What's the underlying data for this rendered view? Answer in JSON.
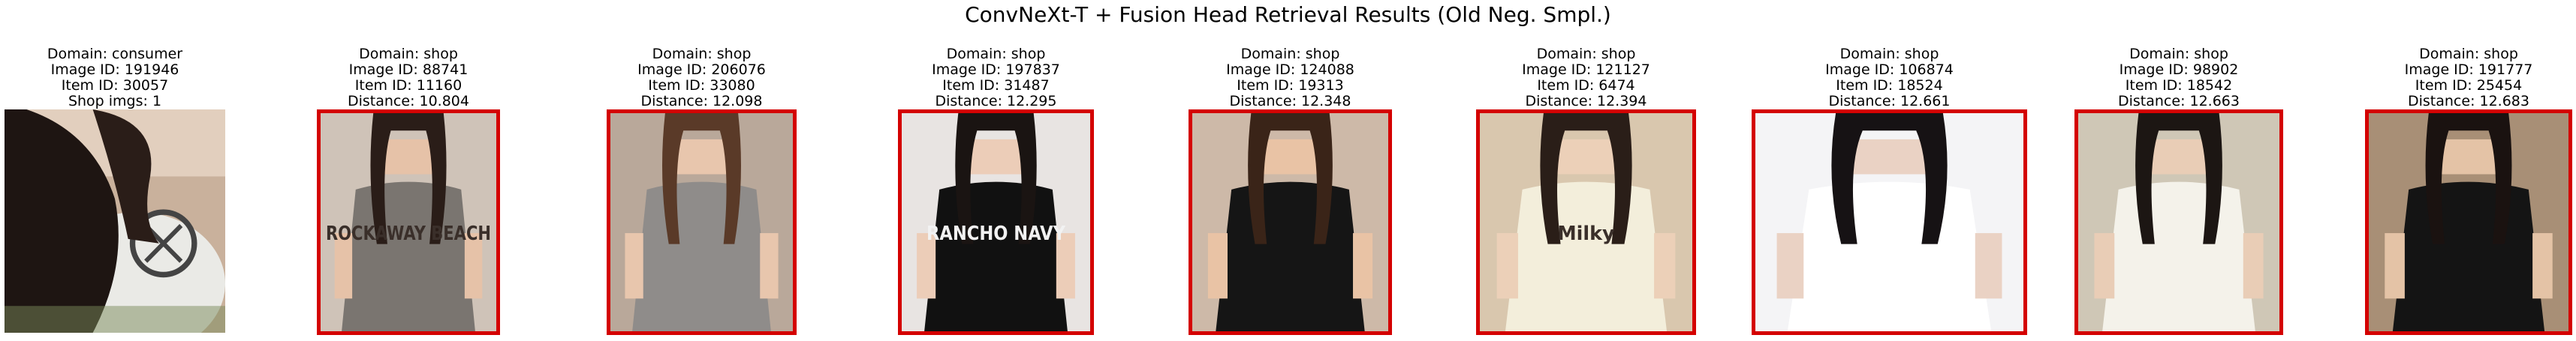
{
  "title": "ConvNeXt-T + Fusion Head Retrieval Results (Old Neg. Smpl.)",
  "query": {
    "domain": "Domain: consumer",
    "image_id": "Image ID: 191946",
    "item_id": "Item ID: 30057",
    "extra": "Shop imgs: 1"
  },
  "results": [
    {
      "domain": "Domain: shop",
      "image_id": "Image ID: 88741",
      "item_id": "Item ID: 11160",
      "distance": "Distance: 10.804",
      "palette": {
        "bg": "#cfc3b8",
        "shirt": "#7a7570",
        "hair": "#2a1d18",
        "skin": "#e6c2a8"
      },
      "print": "ROCKAWAY BEACH"
    },
    {
      "domain": "Domain: shop",
      "image_id": "Image ID: 206076",
      "item_id": "Item ID: 33080",
      "distance": "Distance: 12.098",
      "palette": {
        "bg": "#b9a89a",
        "shirt": "#8f8c8a",
        "hair": "#5a3a28",
        "skin": "#e8c6ad"
      },
      "print": ""
    },
    {
      "domain": "Domain: shop",
      "image_id": "Image ID: 197837",
      "item_id": "Item ID: 31487",
      "distance": "Distance: 12.295",
      "palette": {
        "bg": "#e8e4e2",
        "shirt": "#111111",
        "hair": "#1a1412",
        "skin": "#eccdb8"
      },
      "print": "RANCHO NAVY"
    },
    {
      "domain": "Domain: shop",
      "image_id": "Image ID: 124088",
      "item_id": "Item ID: 19313",
      "distance": "Distance: 12.348",
      "palette": {
        "bg": "#cdb9a8",
        "shirt": "#151515",
        "hair": "#3a2418",
        "skin": "#e9c3a5"
      },
      "print": ""
    },
    {
      "domain": "Domain: shop",
      "image_id": "Image ID: 121127",
      "item_id": "Item ID: 6474",
      "distance": "Distance: 12.394",
      "palette": {
        "bg": "#d9c7ae",
        "shirt": "#f3eedb",
        "hair": "#2a1e18",
        "skin": "#ecd0b8"
      },
      "print": "Milky"
    },
    {
      "domain": "Domain: shop",
      "image_id": "Image ID: 106874",
      "item_id": "Item ID: 18524",
      "distance": "Distance: 12.661",
      "palette": {
        "bg": "#f4f4f6",
        "shirt": "#ffffff",
        "hair": "#161214",
        "skin": "#ead2c4"
      },
      "print": ""
    },
    {
      "domain": "Domain: shop",
      "image_id": "Image ID: 98902",
      "item_id": "Item ID: 18542",
      "distance": "Distance: 12.663",
      "palette": {
        "bg": "#cfc7b6",
        "shirt": "#f4f2ea",
        "hair": "#1c1613",
        "skin": "#e9cdb6"
      },
      "print": ""
    },
    {
      "domain": "Domain: shop",
      "image_id": "Image ID: 191777",
      "item_id": "Item ID: 25454",
      "distance": "Distance: 12.683",
      "palette": {
        "bg": "#a88f76",
        "shirt": "#141414",
        "hair": "#1a1210",
        "skin": "#e4c3a6"
      },
      "print": ""
    }
  ],
  "colors": {
    "match_border": "#d40000"
  }
}
